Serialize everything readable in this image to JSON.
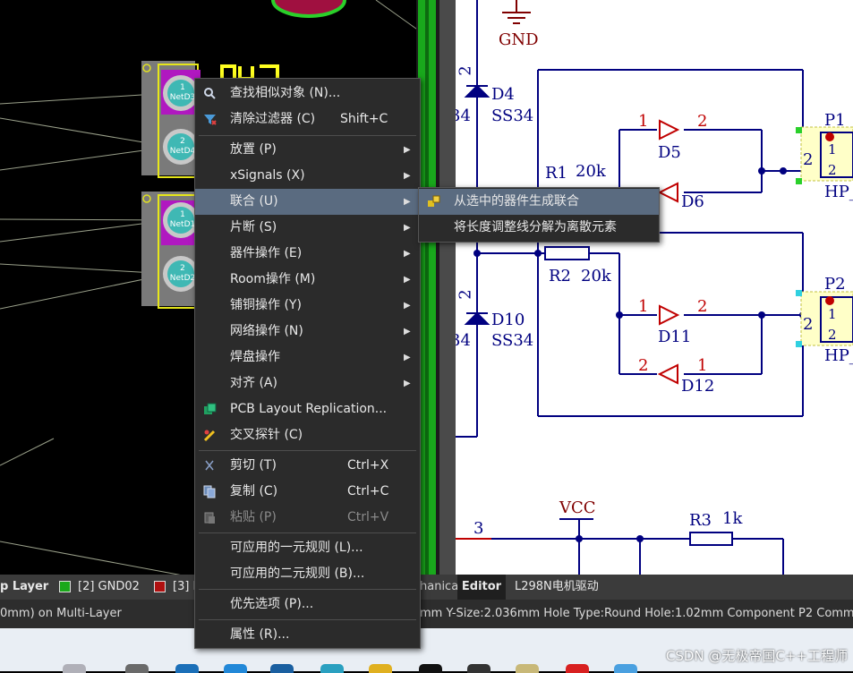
{
  "context_menu": {
    "items": [
      {
        "label": "查找相似对象 (N)...",
        "shortcut": "",
        "submenu": false,
        "icon": "find-similar-icon"
      },
      {
        "label": "清除过滤器 (C)",
        "shortcut": "Shift+C",
        "submenu": false,
        "icon": "clear-filter-icon"
      },
      {
        "label": "放置 (P)",
        "shortcut": "",
        "submenu": true
      },
      {
        "label": "xSignals (X)",
        "shortcut": "",
        "submenu": true
      },
      {
        "label": "联合 (U)",
        "shortcut": "",
        "submenu": true,
        "highlighted": true
      },
      {
        "label": "片断 (S)",
        "shortcut": "",
        "submenu": true
      },
      {
        "label": "器件操作 (E)",
        "shortcut": "",
        "submenu": true
      },
      {
        "label": "Room操作 (M)",
        "shortcut": "",
        "submenu": true
      },
      {
        "label": "铺铜操作 (Y)",
        "shortcut": "",
        "submenu": true
      },
      {
        "label": "网络操作 (N)",
        "shortcut": "",
        "submenu": true
      },
      {
        "label": "焊盘操作",
        "shortcut": "",
        "submenu": true
      },
      {
        "label": "对齐 (A)",
        "shortcut": "",
        "submenu": true
      },
      {
        "label": "PCB Layout Replication...",
        "shortcut": "",
        "submenu": false,
        "icon": "pcb-replication-icon"
      },
      {
        "label": "交叉探针 (C)",
        "shortcut": "",
        "submenu": false,
        "icon": "cross-probe-icon"
      },
      {
        "label": "剪切 (T)",
        "shortcut": "Ctrl+X",
        "submenu": false,
        "icon": "scissors-icon"
      },
      {
        "label": "复制 (C)",
        "shortcut": "Ctrl+C",
        "submenu": false,
        "icon": "copy-icon"
      },
      {
        "label": "粘贴 (P)",
        "shortcut": "Ctrl+V",
        "submenu": false,
        "icon": "paste-icon",
        "disabled": true
      },
      {
        "label": "可应用的一元规则 (L)...",
        "shortcut": "",
        "submenu": false
      },
      {
        "label": "可应用的二元规则 (B)...",
        "shortcut": "",
        "submenu": false
      },
      {
        "label": "优先选项 (P)...",
        "shortcut": "",
        "submenu": false
      },
      {
        "label": "属性 (R)...",
        "shortcut": "",
        "submenu": false
      }
    ]
  },
  "submenu": {
    "items": [
      {
        "label": "从选中的器件生成联合",
        "icon": "union-icon"
      },
      {
        "label": "将长度调整线分解为离散元素"
      }
    ]
  },
  "pcb": {
    "pad_labels": [
      "1",
      "NetD3",
      "2",
      "NetD4",
      "1",
      "NetD1",
      "2",
      "NetD2"
    ],
    "designator_partial": "D3"
  },
  "schematic": {
    "labels": {
      "gnd": "GND",
      "vcc": "VCC",
      "d4": "D4",
      "ss34_1": "SS34",
      "d4_pin2": "2",
      "d10": "D10",
      "ss34_2": "SS34",
      "d10_pin2": "2",
      "d4_left": "34",
      "d10_left": "34",
      "r1": "R1",
      "r1_val": "20k",
      "r2": "R2",
      "r2_val": "20k",
      "d5": "D5",
      "d6": "D6",
      "d11": "D11",
      "d12": "D12",
      "p1": "P1",
      "p2": "P2",
      "hp1": "HP_",
      "hp2": "HP_",
      "r3": "R3",
      "r3_val": "1k",
      "net3": "3",
      "pin1": "1",
      "pin2": "2"
    }
  },
  "layer_tabs": [
    {
      "label": "p Layer",
      "color": "#c0c0c0"
    },
    {
      "label": "[2] GND02",
      "color": "#1aa81a"
    },
    {
      "label": "[3] I",
      "color": "#b01010"
    }
  ],
  "doc_tabs": [
    {
      "label": "hanica"
    },
    {
      "label": "Editor",
      "active": true
    },
    {
      "label": "L298N电机驱动"
    }
  ],
  "status": {
    "left": "0mm) on Multi-Layer",
    "right": "mm Y-Size:2.036mm Hole Type:Round Hole:1.02mm   Component P2 Comment"
  },
  "watermark": "CSDN @无极帝国C++工程师"
}
